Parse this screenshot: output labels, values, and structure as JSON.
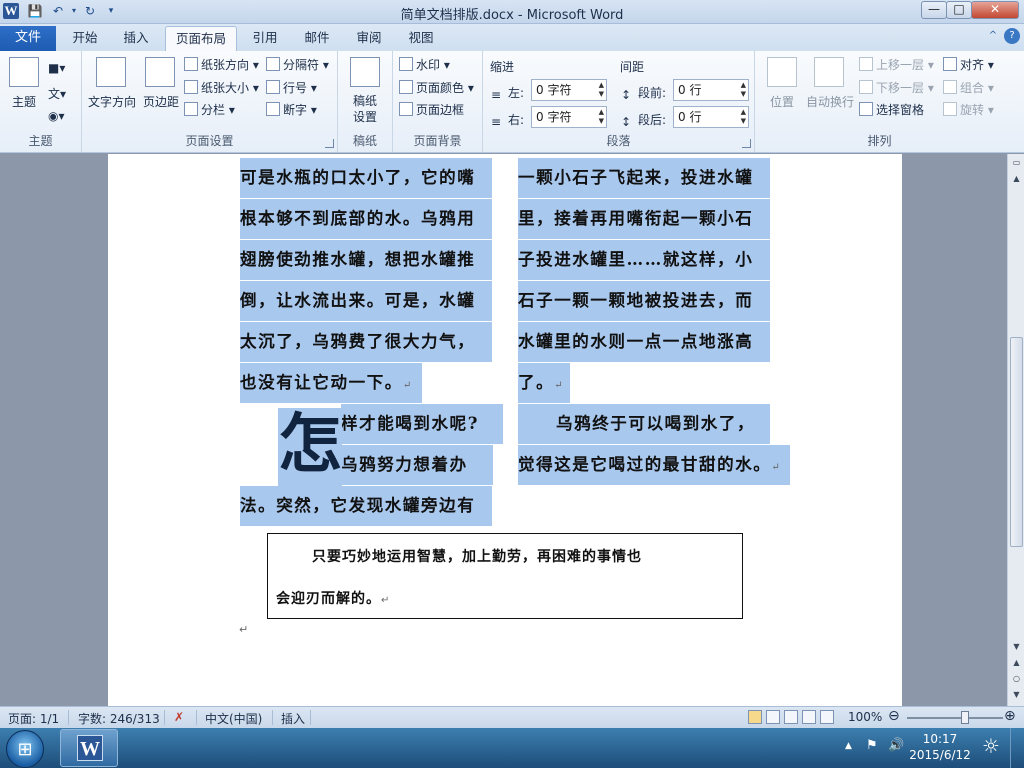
{
  "window": {
    "title": "简单文档排版.docx - Microsoft Word",
    "app_icon_letter": "W",
    "qa_save": "💾",
    "qa_undo": "↶",
    "qa_redo": "↻",
    "qa_more": "▾",
    "min": "—",
    "max": "□",
    "close": "✕"
  },
  "tabs": {
    "file": "文件",
    "items": [
      "开始",
      "插入",
      "页面布局",
      "引用",
      "邮件",
      "审阅",
      "视图"
    ],
    "active": "页面布局",
    "help_icon": "?",
    "collapse_icon": "^"
  },
  "ribbon": {
    "theme": {
      "label": "主题",
      "button": "主题",
      "colors_btn": "■▾",
      "fonts_btn": "文▾",
      "effects_btn": "◉▾"
    },
    "page_setup": {
      "label": "页面设置",
      "text_direction": "文字方向",
      "margins": "页边距",
      "orientation": "纸张方向 ▾",
      "size": "纸张大小 ▾",
      "columns": "分栏 ▾",
      "breaks": "分隔符 ▾",
      "line_numbers": "行号 ▾",
      "hyphenation": "断字 ▾"
    },
    "manuscript": {
      "label": "稿纸",
      "button": "稿纸\n设置"
    },
    "page_background": {
      "label": "页面背景",
      "watermark": "水印 ▾",
      "page_color": "页面颜色 ▾",
      "page_borders": "页面边框"
    },
    "paragraph": {
      "label": "段落",
      "indent_title": "缩进",
      "left_label": "左:",
      "left_value": "0 字符",
      "right_label": "右:",
      "right_value": "0 字符",
      "spacing_title": "间距",
      "before_label": "段前:",
      "before_value": "0 行",
      "after_label": "段后:",
      "after_value": "0 行"
    },
    "arrange": {
      "label": "排列",
      "position": "位置",
      "wrap_text": "自动换行",
      "bring_forward": "上移一层 ▾",
      "send_backward": "下移一层 ▾",
      "selection_pane": "选择窗格",
      "align": "对齐 ▾",
      "group": "组合 ▾",
      "rotate": "旋转 ▾"
    }
  },
  "document": {
    "left_col_lines": [
      "可是水瓶的口太小了，它的嘴",
      "根本够不到底部的水。乌鸦用",
      "翅膀使劲推水罐，想把水罐推",
      "倒，让水流出来。可是，水罐",
      "太沉了，乌鸦费了很大力气，",
      "也没有让它动一下。"
    ],
    "dropcap_char": "怎",
    "dropcap_lines": [
      "样才能喝到水呢?",
      "乌鸦努力想着办"
    ],
    "left_final_line": "法。突然，它发现水罐旁边有",
    "right_col_lines": [
      "一颗小石子飞起来，投进水罐",
      "里，接着再用嘴衔起一颗小石",
      "子投进水罐里……就这样，小",
      "石子一颗一颗地被投进去，而",
      "水罐里的水则一点一点地涨高",
      "了。"
    ],
    "right_para2_lines": [
      "乌鸦终于可以喝到水了，",
      "觉得这是它喝过的最甘甜的水。"
    ],
    "para_mark": "↵",
    "note_line1": "只要巧妙地运用智慧，加上勤劳，再困难的事情也",
    "note_line2": "会迎刃而解的。"
  },
  "statusbar": {
    "page": "页面: 1/1",
    "words": "字数: 246/313",
    "language": "中文(中国)",
    "insert_mode": "插入",
    "zoom": "100%",
    "zoom_minus": "⊖",
    "zoom_plus": "⊕",
    "zoom_fraction": 0.6
  },
  "taskbar": {
    "time": "10:17",
    "date": "2015/6/12",
    "tray_up": "▲",
    "tray_flag": "⚑",
    "tray_volume": "🔊",
    "start_glyph": "⊞",
    "word_letter": "W"
  }
}
